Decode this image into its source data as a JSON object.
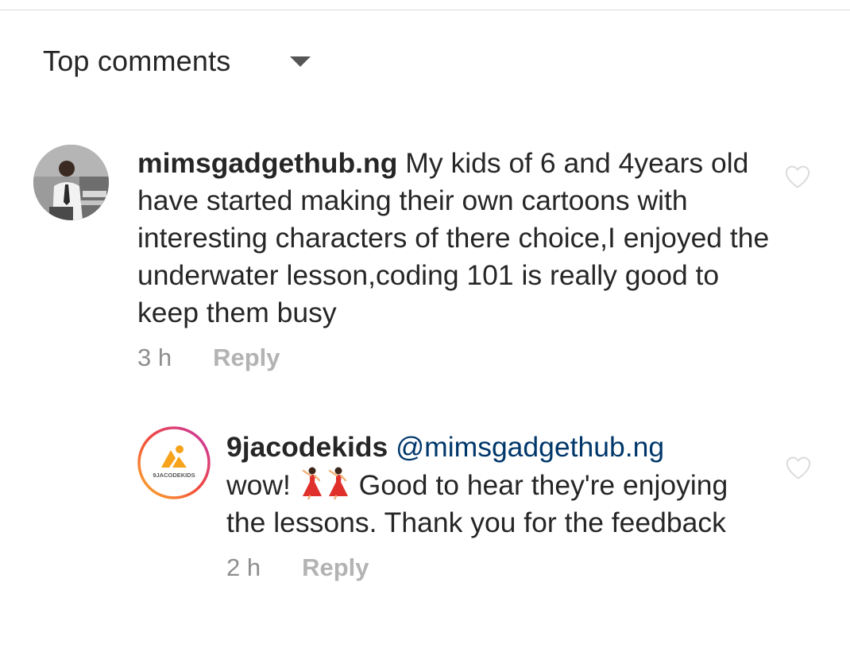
{
  "header": {
    "sort_label": "Top comments",
    "sort_caret_icon": "chevron-down-icon"
  },
  "comments": [
    {
      "username": "mimsgadgethub.ng",
      "text": "My kids of 6 and 4years old have started making their own cartoons with interesting characters of there choice,I enjoyed the underwater lesson,coding 101 is really good to keep them busy",
      "time": "3 h",
      "reply_label": "Reply",
      "like_icon": "heart-outline-icon"
    }
  ],
  "replies": [
    {
      "username": "9jacodekids",
      "mention": "@mimsgadgethub.ng",
      "text_before_emoji": "wow!",
      "emoji_icons": [
        "dancer-emoji-icon",
        "dancer-emoji-icon"
      ],
      "text_after_emoji": "Good to hear they're enjoying the lessons. Thank you for the feedback",
      "avatar_text": "9JACODEKIDS",
      "time": "2 h",
      "reply_label": "Reply",
      "like_icon": "heart-outline-icon"
    }
  ],
  "colors": {
    "text": "#262626",
    "muted": "#8e8e8e",
    "reply": "#b3b3b3",
    "mention": "#00376b",
    "brand_orange": "#f7a31c",
    "story_ring_start": "#fdb12a",
    "story_ring_end": "#c837ab"
  }
}
